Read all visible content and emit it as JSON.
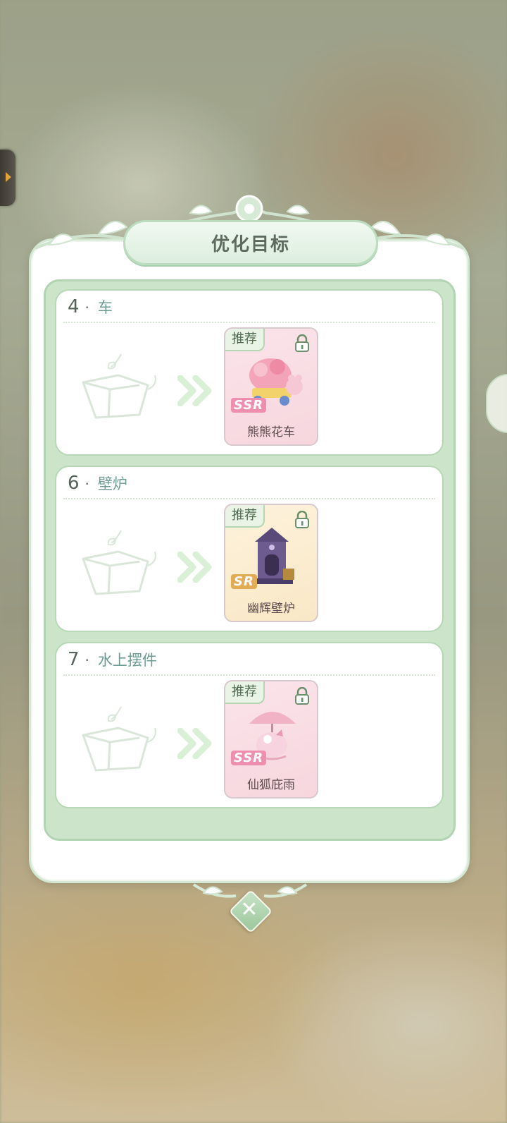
{
  "dialog": {
    "title": "优化目标",
    "close_icon": "close-icon"
  },
  "targets": [
    {
      "number": "4",
      "dot": "·",
      "name": "车",
      "badge": "推荐",
      "rarity": "SSR",
      "item": "熊熊花车"
    },
    {
      "number": "6",
      "dot": "·",
      "name": "壁炉",
      "badge": "推荐",
      "rarity": "SR",
      "item": "幽辉壁炉"
    },
    {
      "number": "7",
      "dot": "·",
      "name": "水上摆件",
      "badge": "推荐",
      "rarity": "SSR",
      "item": "仙狐庇雨"
    }
  ],
  "colors": {
    "accent_green": "#cbe4ca",
    "ssr_pink": "#ee8fb0",
    "sr_gold": "#e2ab55"
  }
}
